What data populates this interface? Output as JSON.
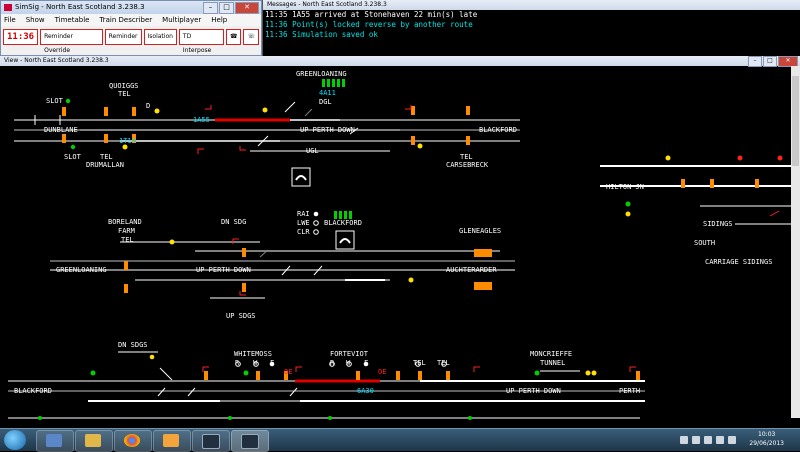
{
  "sim_window": {
    "title": "SimSig - North East Scotland 3.238.3",
    "menu": [
      "File",
      "Show",
      "Timetable",
      "Train Describer",
      "Multiplayer",
      "Help"
    ],
    "clock": "11:36",
    "toolbar": [
      "Reminder Override",
      "Reminder",
      "Isolation",
      "TD Interpose"
    ],
    "min_label": "–",
    "max_label": "□",
    "close_label": "✕"
  },
  "messages": {
    "title": "Messages - North East Scotland 3.238.3",
    "lines": [
      {
        "text": "11:35 1A55 arrived at Stonehaven 22 min(s) late",
        "color": "#ffffff"
      },
      {
        "text": "11:36 Point(s) locked reverse by another route",
        "color": "#00e5e5"
      },
      {
        "text": "11:36 Simulation saved ok",
        "color": "#00e5e5"
      }
    ]
  },
  "view": {
    "title": "View - North East Scotland 3.238.3",
    "labels": {
      "quoiggs": "QUOIGGS",
      "tel": "TEL",
      "slot": "SLOT",
      "greenloaning": "GREENLOANING",
      "td_4a11": "4A11",
      "dgl": "DGL",
      "dunblane": "DUNBLANE",
      "td_1a55": "1A55",
      "up_perth_down": "UP PERTH DOWN",
      "blackford": "BLACKFORD",
      "td_1t14": "1T14",
      "ugl": "UGL",
      "drumallan": "DRUMALLAN",
      "carsebreck": "CARSEBRECK",
      "hilton_jn": "HILTON JN",
      "boreland": "BORELAND",
      "farm": "FARM",
      "dn_sdg": "DN SDG",
      "rai": "RAI",
      "lwe": "LWE",
      "clr": "CLR",
      "gleneagles": "GLENEAGLES",
      "auchterarder": "AUCHTERARDER",
      "up_sdgs": "UP SDGS",
      "sidings": "SIDINGS",
      "south": "SOUTH",
      "carriage_sidings": "CARRIAGE SIDINGS",
      "dn_sdgs": "DN SDGS",
      "whitemoss": "WHITEMOSS",
      "forteviot": "FORTEVIOT",
      "moncrieffe": "MONCRIEFFE",
      "tunnel": "TUNNEL",
      "perth": "PERTH",
      "td_6a30": "6A30",
      "oe": "OE",
      "r": "R",
      "w": "W",
      "f": "F",
      "d": "D"
    }
  },
  "taskbar": {
    "time": "10:03",
    "date": "29/06/2013",
    "apps": [
      "windows-explorer",
      "file-manager",
      "chrome",
      "outlook",
      "simsig-1",
      "simsig-2"
    ]
  },
  "colors": {
    "track": "#808080",
    "track_set": "#ffffff",
    "track_occupied": "#e00000",
    "signal_red": "#ff2020",
    "signal_green": "#00d000",
    "signal_yellow": "#ffe000",
    "label": "#ffffff",
    "td_cyan": "#00e0ff",
    "platform": "#ff8c00",
    "bridge": "#00ff00"
  }
}
